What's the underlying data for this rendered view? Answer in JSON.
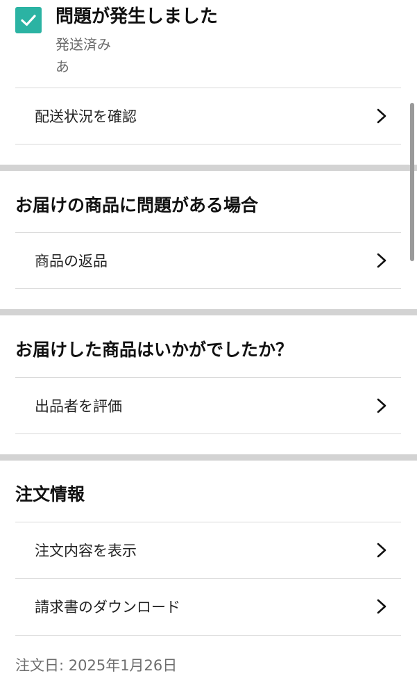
{
  "status": {
    "title": "問題が発生しました",
    "subtitle": "発送済み",
    "note": "あ",
    "check_color": "#2bb3a3"
  },
  "rows": {
    "tracking": "配送状況を確認",
    "return": "商品の返品",
    "rate_seller": "出品者を評価",
    "view_order": "注文内容を表示",
    "invoice": "請求書のダウンロード"
  },
  "sections": {
    "problem": "お届けの商品に問題がある場合",
    "feedback": "お届けした商品はいかがでしたか？",
    "order_info": "注文情報"
  },
  "order_date": "注文日: 2025年1月26日",
  "icons": {
    "check": "check-icon",
    "chevron": "chevron-right-icon"
  }
}
